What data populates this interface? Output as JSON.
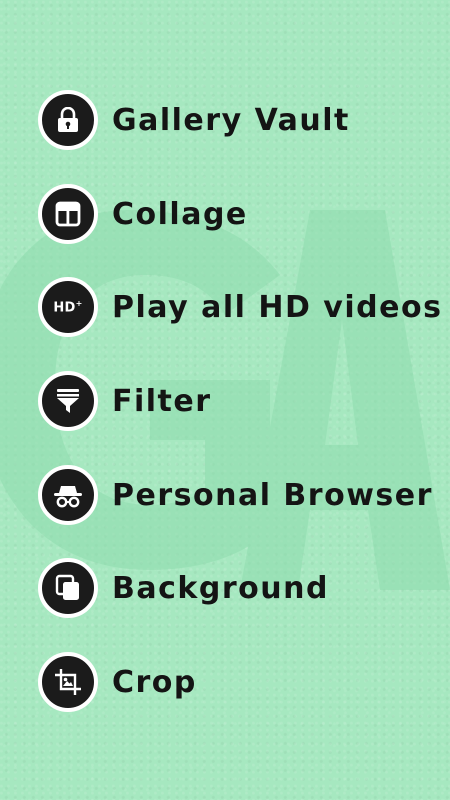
{
  "features": [
    {
      "label": "Gallery Vault",
      "icon": "lock-icon"
    },
    {
      "label": "Collage",
      "icon": "collage-layout-icon"
    },
    {
      "label": "Play all HD videos",
      "icon": "hd-plus-icon",
      "icon_text": "HD",
      "icon_superscript": "+"
    },
    {
      "label": "Filter",
      "icon": "filter-funnel-icon"
    },
    {
      "label": "Personal Browser",
      "icon": "incognito-icon"
    },
    {
      "label": "Background",
      "icon": "background-layers-icon"
    },
    {
      "label": "Crop",
      "icon": "crop-icon"
    }
  ],
  "colors": {
    "background": "#a6e8c0",
    "watermark": "#8fdcae",
    "badge": "#1b1b1b",
    "badge_border": "#ffffff",
    "text": "#141414"
  }
}
